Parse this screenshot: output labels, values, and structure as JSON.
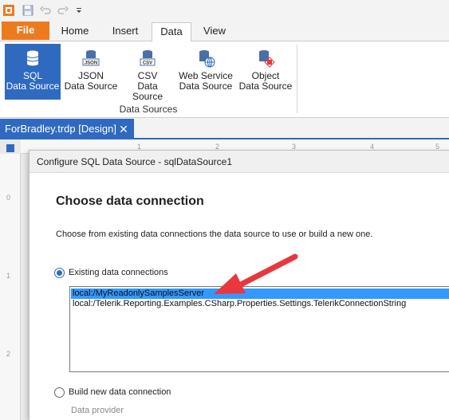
{
  "ribbon_tabs": {
    "file": "File",
    "home": "Home",
    "insert": "Insert",
    "data": "Data",
    "view": "View"
  },
  "ribbon": {
    "buttons": [
      {
        "line1": "SQL",
        "line2": "Data Source",
        "icon": "database-icon",
        "active": true
      },
      {
        "line1": "JSON",
        "line2": "Data Source",
        "icon": "json-icon",
        "active": false
      },
      {
        "line1": "CSV",
        "line2": "Data Source",
        "icon": "csv-icon",
        "active": false
      },
      {
        "line1": "Web Service",
        "line2": "Data Source",
        "icon": "web-service-icon",
        "active": false
      },
      {
        "line1": "Object",
        "line2": "Data Source",
        "icon": "object-icon",
        "active": false
      }
    ],
    "group_label": "Data Sources"
  },
  "document": {
    "tab_title": "ForBradley.trdp [Design]",
    "close_glyph": "✕"
  },
  "ruler": {
    "h_ticks": [
      "1",
      "2",
      "3",
      "4",
      "5"
    ],
    "v_ticks": [
      "0",
      "1",
      "2"
    ]
  },
  "dialog": {
    "title": "Configure SQL Data Source - sqlDataSource1",
    "heading": "Choose data connection",
    "description": "Choose from existing data connections the data source to use or build a new one.",
    "existing_label": "Existing data connections",
    "connections": [
      {
        "text": "local:/MyReadonlySamplesServer",
        "selected": true
      },
      {
        "text": "local:/Telerik.Reporting.Examples.CSharp.Properties.Settings.TelerikConnectionString",
        "selected": false
      }
    ],
    "build_new_label": "Build new data connection",
    "data_provider_label": "Data provider",
    "selected_option": "existing"
  },
  "colors": {
    "accent": "#2f6ac0",
    "file_tab": "#ee7a1e",
    "selection": "#3399ff",
    "annotation_arrow": "#e8383d"
  }
}
